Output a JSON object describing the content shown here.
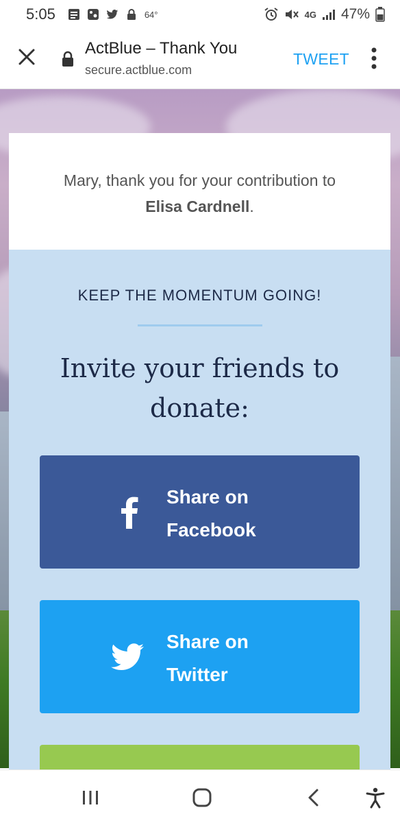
{
  "status_bar": {
    "time": "5:05",
    "temperature": "64°",
    "battery_percent": "47%",
    "network": "4G"
  },
  "browser": {
    "title": "ActBlue – Thank You",
    "url": "secure.actblue.com",
    "tweet_label": "TWEET",
    "icons": [
      "close-icon",
      "lock-icon",
      "more-vertical-icon"
    ]
  },
  "thank_you": {
    "message": "Mary, thank you for your contribution to",
    "recipient": "Elisa Cardnell",
    "punctuation": "."
  },
  "momentum": {
    "heading": "KEEP THE MOMENTUM GOING!",
    "invite": "Invite your friends to donate:"
  },
  "share": {
    "facebook": {
      "label": "Share on Facebook",
      "color": "#3b5998",
      "icon": "facebook-icon"
    },
    "twitter": {
      "label": "Share on Twitter",
      "color": "#1da1f2",
      "icon": "twitter-icon"
    },
    "third_button_color": "#97c950"
  },
  "nav": {
    "icons": [
      "recent-apps-icon",
      "home-icon",
      "back-icon",
      "accessibility-icon"
    ]
  },
  "colors": {
    "accent_blue": "#1da1f2",
    "facebook_blue": "#3b5998",
    "panel_bg": "#c8def2",
    "heading_navy": "#1d2a48"
  }
}
